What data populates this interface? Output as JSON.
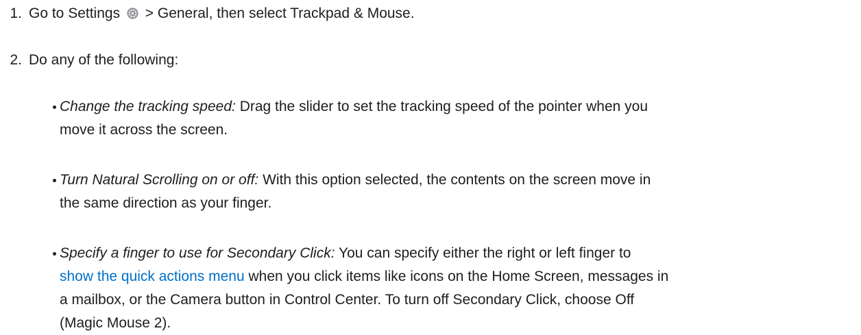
{
  "steps": [
    {
      "number": "1.",
      "text_before_icon": "Go to Settings",
      "icon": "settings-gear-icon",
      "text_after_icon": "> General, then select Trackpad & Mouse."
    },
    {
      "number": "2.",
      "text": "Do any of the following:"
    }
  ],
  "bullets": [
    {
      "term": "Change the tracking speed:",
      "text": "Drag the slider to set the tracking speed of the pointer when you",
      "text2": "move it across the screen."
    },
    {
      "term": "Turn Natural Scrolling on or off:",
      "text": "With this option selected, the contents on the screen move in",
      "text2": "the same direction as your finger."
    },
    {
      "term": "Specify a finger to use for Secondary Click:",
      "text": "You can specify either the right or left finger to",
      "link": "show the quick actions menu",
      "text2": "when you click items like icons on the Home Screen, messages in",
      "text3": "a mailbox, or the Camera button in Control Center. To turn off Secondary Click, choose Off",
      "text4": "(Magic Mouse 2)."
    }
  ],
  "colors": {
    "text": "#1d1d1f",
    "link": "#0070c9",
    "icon_gray": "#8e8e93"
  }
}
